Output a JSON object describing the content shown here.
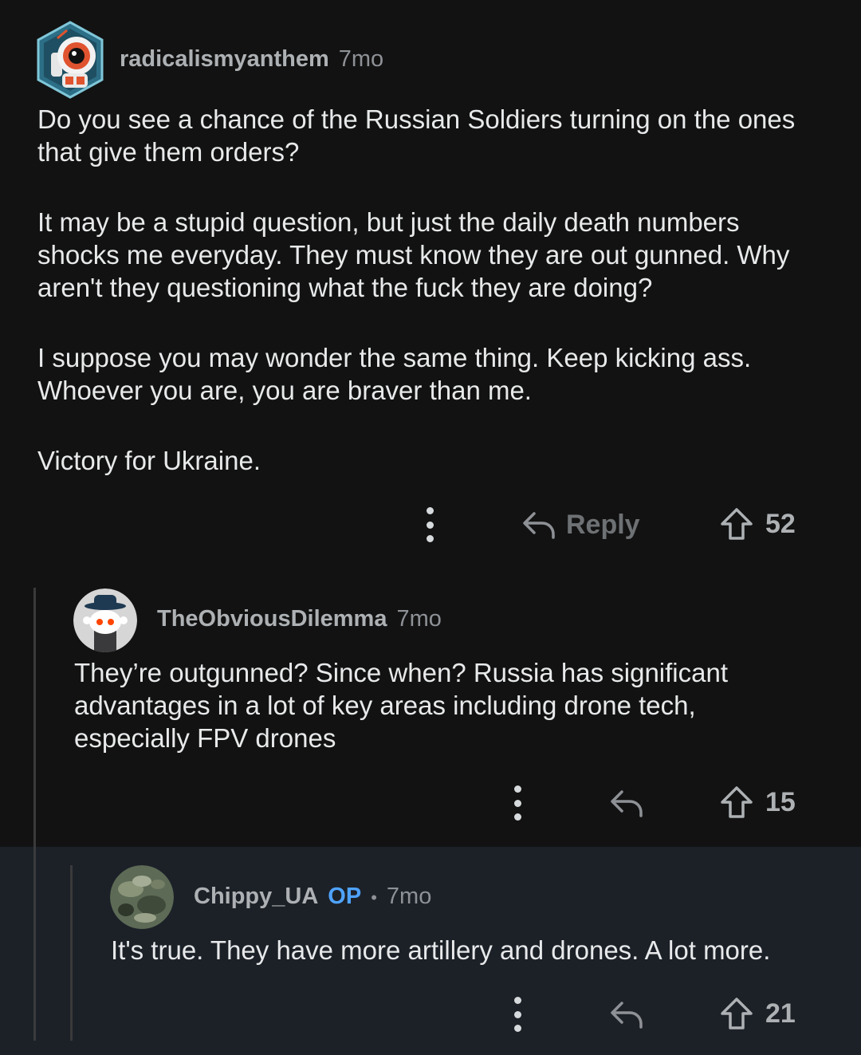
{
  "comments": [
    {
      "username": "radicalismyanthem",
      "time": "7mo",
      "paragraphs": [
        "Do you see a chance of the Russian Soldiers turning on the ones that give them orders?",
        "It may be a stupid question, but just the daily death numbers shocks me everyday. They must know they are out gunned. Why aren't they questioning what the fuck they are doing?",
        "I suppose you may wonder the same thing. Keep kicking ass. Whoever you are, you are braver than me.",
        "Victory for Ukraine."
      ],
      "reply_label": "Reply",
      "votes": "52"
    },
    {
      "username": "TheObviousDilemma",
      "time": "7mo",
      "paragraphs": [
        "They’re outgunned? Since when? Russia has significant advantages in a lot of key areas including drone tech, especially FPV drones"
      ],
      "votes": "15"
    },
    {
      "username": "Chippy_UA",
      "badge": "OP",
      "separator": "•",
      "time": "7mo",
      "paragraphs": [
        "It's true. They have more artillery and drones. A lot more."
      ],
      "votes": "21"
    }
  ],
  "colors": {
    "background": "#121212",
    "highlight": "#1c2128",
    "op_badge": "#4fa3ff"
  }
}
